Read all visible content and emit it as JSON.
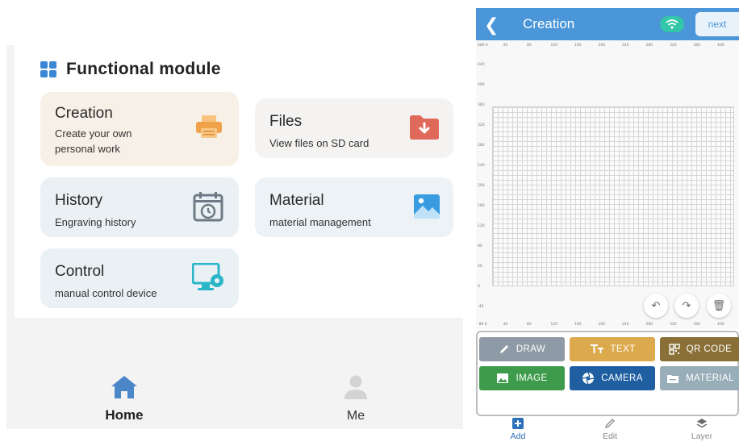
{
  "left": {
    "module_title": "Functional module",
    "tiles": [
      {
        "title": "Creation",
        "subtitle": "Create your own personal work",
        "icon": "printer-icon"
      },
      {
        "title": "Files",
        "subtitle": "View files on SD card",
        "icon": "download-folder-icon"
      },
      {
        "title": "History",
        "subtitle": "Engraving history",
        "icon": "calendar-clock-icon"
      },
      {
        "title": "Material",
        "subtitle": "material management",
        "icon": "image-icon"
      },
      {
        "title": "Control",
        "subtitle": "manual control device",
        "icon": "monitor-gear-icon"
      }
    ],
    "nav": {
      "home": "Home",
      "me": "Me"
    }
  },
  "right": {
    "title": "Creation",
    "next": "next",
    "ruler_top": [
      "480 0",
      "40",
      "80",
      "120",
      "160",
      "200",
      "240",
      "280",
      "320",
      "360",
      "400"
    ],
    "ruler_bottom": [
      "-80 0",
      "40",
      "80",
      "120",
      "160",
      "200",
      "240",
      "280",
      "320",
      "360",
      "400"
    ],
    "ruler_left": [
      "440",
      "400",
      "360",
      "320",
      "280",
      "240",
      "200",
      "160",
      "120",
      "80",
      "40",
      "0",
      "-40"
    ],
    "tools": {
      "draw": "DRAW",
      "text": "TEXT",
      "qr": "QR CODE",
      "image": "IMAGE",
      "camera": "CAMERA",
      "material": "MATERIAL"
    },
    "tabs": {
      "add": "Add",
      "edit": "Edit",
      "layer": "Layer"
    }
  },
  "colors": {
    "accent": "#4a96d8",
    "wifi": "#34c6a8",
    "creation_icon": "#f0a24a",
    "files_icon": "#e06a5a",
    "history_icon": "#6d7a85",
    "material_icon": "#3a9ce0",
    "control_icon": "#2bb6c8"
  }
}
